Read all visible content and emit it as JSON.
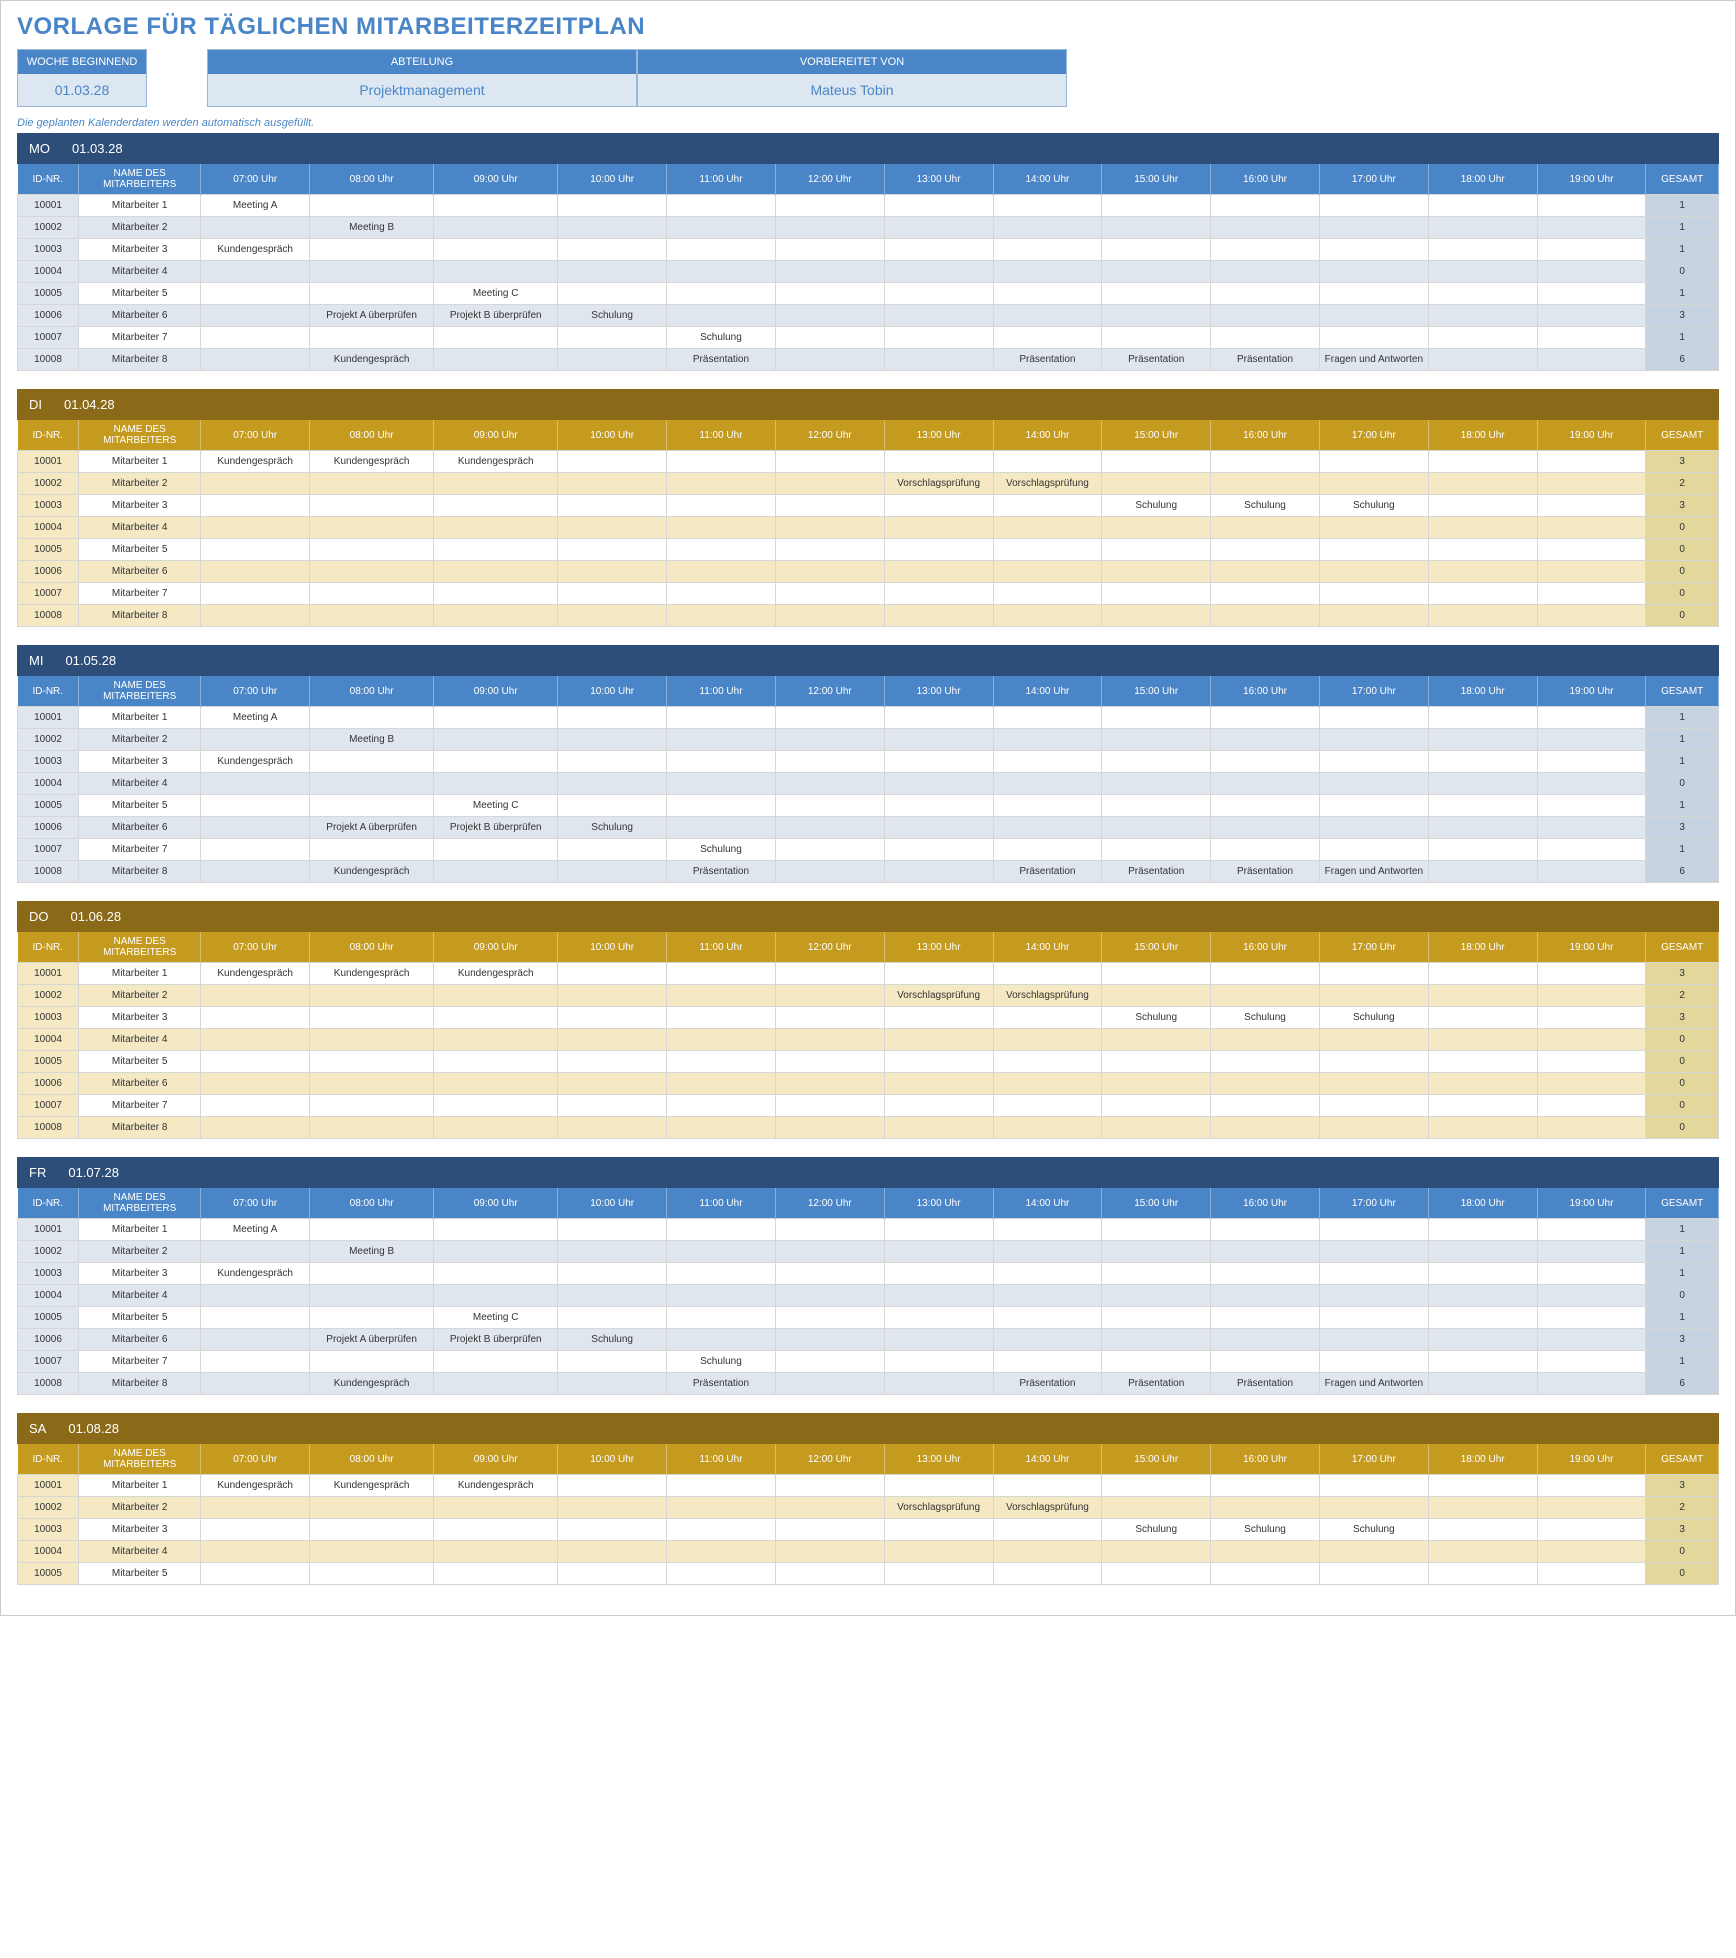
{
  "title": "VORLAGE FÜR TÄGLICHEN MITARBEITERZEITPLAN",
  "cards": {
    "week_label": "WOCHE BEGINNEND",
    "week_value": "01.03.28",
    "dept_label": "ABTEILUNG",
    "dept_value": "Projektmanagement",
    "prep_label": "VORBEREITET VON",
    "prep_value": "Mateus Tobin"
  },
  "note": "Die geplanten Kalenderdaten werden automatisch ausgefüllt.",
  "headers": {
    "id": "ID-NR.",
    "name": "NAME DES MITARBEITERS",
    "total": "GESAMT",
    "hours": [
      "07:00 Uhr",
      "08:00 Uhr",
      "09:00 Uhr",
      "10:00 Uhr",
      "11:00 Uhr",
      "12:00 Uhr",
      "13:00 Uhr",
      "14:00 Uhr",
      "15:00 Uhr",
      "16:00 Uhr",
      "17:00 Uhr",
      "18:00 Uhr",
      "19:00 Uhr"
    ]
  },
  "days": [
    {
      "theme": "blue",
      "code": "MO",
      "date": "01.03.28",
      "rows": [
        {
          "id": "10001",
          "name": "Mitarbeiter 1",
          "cells": [
            "Meeting A",
            "",
            "",
            "",
            "",
            "",
            "",
            "",
            "",
            "",
            "",
            "",
            ""
          ],
          "total": "1"
        },
        {
          "id": "10002",
          "name": "Mitarbeiter 2",
          "cells": [
            "",
            "Meeting B",
            "",
            "",
            "",
            "",
            "",
            "",
            "",
            "",
            "",
            "",
            ""
          ],
          "total": "1"
        },
        {
          "id": "10003",
          "name": "Mitarbeiter 3",
          "cells": [
            "Kundengespräch",
            "",
            "",
            "",
            "",
            "",
            "",
            "",
            "",
            "",
            "",
            "",
            ""
          ],
          "total": "1"
        },
        {
          "id": "10004",
          "name": "Mitarbeiter 4",
          "cells": [
            "",
            "",
            "",
            "",
            "",
            "",
            "",
            "",
            "",
            "",
            "",
            "",
            ""
          ],
          "total": "0"
        },
        {
          "id": "10005",
          "name": "Mitarbeiter 5",
          "cells": [
            "",
            "",
            "Meeting C",
            "",
            "",
            "",
            "",
            "",
            "",
            "",
            "",
            "",
            ""
          ],
          "total": "1"
        },
        {
          "id": "10006",
          "name": "Mitarbeiter 6",
          "cells": [
            "",
            "Projekt A überprüfen",
            "Projekt B überprüfen",
            "Schulung",
            "",
            "",
            "",
            "",
            "",
            "",
            "",
            "",
            ""
          ],
          "total": "3"
        },
        {
          "id": "10007",
          "name": "Mitarbeiter 7",
          "cells": [
            "",
            "",
            "",
            "",
            "Schulung",
            "",
            "",
            "",
            "",
            "",
            "",
            "",
            ""
          ],
          "total": "1"
        },
        {
          "id": "10008",
          "name": "Mitarbeiter 8",
          "cells": [
            "",
            "Kundengespräch",
            "",
            "",
            "Präsentation",
            "",
            "",
            "Präsentation",
            "Präsentation",
            "Präsentation",
            "Fragen und Antworten",
            "",
            ""
          ],
          "total": "6"
        }
      ]
    },
    {
      "theme": "brown",
      "code": "DI",
      "date": "01.04.28",
      "rows": [
        {
          "id": "10001",
          "name": "Mitarbeiter 1",
          "cells": [
            "Kundengespräch",
            "Kundengespräch",
            "Kundengespräch",
            "",
            "",
            "",
            "",
            "",
            "",
            "",
            "",
            "",
            ""
          ],
          "total": "3"
        },
        {
          "id": "10002",
          "name": "Mitarbeiter 2",
          "cells": [
            "",
            "",
            "",
            "",
            "",
            "",
            "Vorschlagsprüfung",
            "Vorschlagsprüfung",
            "",
            "",
            "",
            "",
            ""
          ],
          "total": "2"
        },
        {
          "id": "10003",
          "name": "Mitarbeiter 3",
          "cells": [
            "",
            "",
            "",
            "",
            "",
            "",
            "",
            "",
            "Schulung",
            "Schulung",
            "Schulung",
            "",
            ""
          ],
          "total": "3"
        },
        {
          "id": "10004",
          "name": "Mitarbeiter 4",
          "cells": [
            "",
            "",
            "",
            "",
            "",
            "",
            "",
            "",
            "",
            "",
            "",
            "",
            ""
          ],
          "total": "0"
        },
        {
          "id": "10005",
          "name": "Mitarbeiter 5",
          "cells": [
            "",
            "",
            "",
            "",
            "",
            "",
            "",
            "",
            "",
            "",
            "",
            "",
            ""
          ],
          "total": "0"
        },
        {
          "id": "10006",
          "name": "Mitarbeiter 6",
          "cells": [
            "",
            "",
            "",
            "",
            "",
            "",
            "",
            "",
            "",
            "",
            "",
            "",
            ""
          ],
          "total": "0"
        },
        {
          "id": "10007",
          "name": "Mitarbeiter 7",
          "cells": [
            "",
            "",
            "",
            "",
            "",
            "",
            "",
            "",
            "",
            "",
            "",
            "",
            ""
          ],
          "total": "0"
        },
        {
          "id": "10008",
          "name": "Mitarbeiter 8",
          "cells": [
            "",
            "",
            "",
            "",
            "",
            "",
            "",
            "",
            "",
            "",
            "",
            "",
            ""
          ],
          "total": "0"
        }
      ]
    },
    {
      "theme": "blue",
      "code": "MI",
      "date": "01.05.28",
      "rows": [
        {
          "id": "10001",
          "name": "Mitarbeiter 1",
          "cells": [
            "Meeting A",
            "",
            "",
            "",
            "",
            "",
            "",
            "",
            "",
            "",
            "",
            "",
            ""
          ],
          "total": "1"
        },
        {
          "id": "10002",
          "name": "Mitarbeiter 2",
          "cells": [
            "",
            "Meeting B",
            "",
            "",
            "",
            "",
            "",
            "",
            "",
            "",
            "",
            "",
            ""
          ],
          "total": "1"
        },
        {
          "id": "10003",
          "name": "Mitarbeiter 3",
          "cells": [
            "Kundengespräch",
            "",
            "",
            "",
            "",
            "",
            "",
            "",
            "",
            "",
            "",
            "",
            ""
          ],
          "total": "1"
        },
        {
          "id": "10004",
          "name": "Mitarbeiter 4",
          "cells": [
            "",
            "",
            "",
            "",
            "",
            "",
            "",
            "",
            "",
            "",
            "",
            "",
            ""
          ],
          "total": "0"
        },
        {
          "id": "10005",
          "name": "Mitarbeiter 5",
          "cells": [
            "",
            "",
            "Meeting C",
            "",
            "",
            "",
            "",
            "",
            "",
            "",
            "",
            "",
            ""
          ],
          "total": "1"
        },
        {
          "id": "10006",
          "name": "Mitarbeiter 6",
          "cells": [
            "",
            "Projekt A überprüfen",
            "Projekt B überprüfen",
            "Schulung",
            "",
            "",
            "",
            "",
            "",
            "",
            "",
            "",
            ""
          ],
          "total": "3"
        },
        {
          "id": "10007",
          "name": "Mitarbeiter 7",
          "cells": [
            "",
            "",
            "",
            "",
            "Schulung",
            "",
            "",
            "",
            "",
            "",
            "",
            "",
            ""
          ],
          "total": "1"
        },
        {
          "id": "10008",
          "name": "Mitarbeiter 8",
          "cells": [
            "",
            "Kundengespräch",
            "",
            "",
            "Präsentation",
            "",
            "",
            "Präsentation",
            "Präsentation",
            "Präsentation",
            "Fragen und Antworten",
            "",
            ""
          ],
          "total": "6"
        }
      ]
    },
    {
      "theme": "brown",
      "code": "DO",
      "date": "01.06.28",
      "rows": [
        {
          "id": "10001",
          "name": "Mitarbeiter 1",
          "cells": [
            "Kundengespräch",
            "Kundengespräch",
            "Kundengespräch",
            "",
            "",
            "",
            "",
            "",
            "",
            "",
            "",
            "",
            ""
          ],
          "total": "3"
        },
        {
          "id": "10002",
          "name": "Mitarbeiter 2",
          "cells": [
            "",
            "",
            "",
            "",
            "",
            "",
            "Vorschlagsprüfung",
            "Vorschlagsprüfung",
            "",
            "",
            "",
            "",
            ""
          ],
          "total": "2"
        },
        {
          "id": "10003",
          "name": "Mitarbeiter 3",
          "cells": [
            "",
            "",
            "",
            "",
            "",
            "",
            "",
            "",
            "Schulung",
            "Schulung",
            "Schulung",
            "",
            ""
          ],
          "total": "3"
        },
        {
          "id": "10004",
          "name": "Mitarbeiter 4",
          "cells": [
            "",
            "",
            "",
            "",
            "",
            "",
            "",
            "",
            "",
            "",
            "",
            "",
            ""
          ],
          "total": "0"
        },
        {
          "id": "10005",
          "name": "Mitarbeiter 5",
          "cells": [
            "",
            "",
            "",
            "",
            "",
            "",
            "",
            "",
            "",
            "",
            "",
            "",
            ""
          ],
          "total": "0"
        },
        {
          "id": "10006",
          "name": "Mitarbeiter 6",
          "cells": [
            "",
            "",
            "",
            "",
            "",
            "",
            "",
            "",
            "",
            "",
            "",
            "",
            ""
          ],
          "total": "0"
        },
        {
          "id": "10007",
          "name": "Mitarbeiter 7",
          "cells": [
            "",
            "",
            "",
            "",
            "",
            "",
            "",
            "",
            "",
            "",
            "",
            "",
            ""
          ],
          "total": "0"
        },
        {
          "id": "10008",
          "name": "Mitarbeiter 8",
          "cells": [
            "",
            "",
            "",
            "",
            "",
            "",
            "",
            "",
            "",
            "",
            "",
            "",
            ""
          ],
          "total": "0"
        }
      ]
    },
    {
      "theme": "blue",
      "code": "FR",
      "date": "01.07.28",
      "rows": [
        {
          "id": "10001",
          "name": "Mitarbeiter 1",
          "cells": [
            "Meeting A",
            "",
            "",
            "",
            "",
            "",
            "",
            "",
            "",
            "",
            "",
            "",
            ""
          ],
          "total": "1"
        },
        {
          "id": "10002",
          "name": "Mitarbeiter 2",
          "cells": [
            "",
            "Meeting B",
            "",
            "",
            "",
            "",
            "",
            "",
            "",
            "",
            "",
            "",
            ""
          ],
          "total": "1"
        },
        {
          "id": "10003",
          "name": "Mitarbeiter 3",
          "cells": [
            "Kundengespräch",
            "",
            "",
            "",
            "",
            "",
            "",
            "",
            "",
            "",
            "",
            "",
            ""
          ],
          "total": "1"
        },
        {
          "id": "10004",
          "name": "Mitarbeiter 4",
          "cells": [
            "",
            "",
            "",
            "",
            "",
            "",
            "",
            "",
            "",
            "",
            "",
            "",
            ""
          ],
          "total": "0"
        },
        {
          "id": "10005",
          "name": "Mitarbeiter 5",
          "cells": [
            "",
            "",
            "Meeting C",
            "",
            "",
            "",
            "",
            "",
            "",
            "",
            "",
            "",
            ""
          ],
          "total": "1"
        },
        {
          "id": "10006",
          "name": "Mitarbeiter 6",
          "cells": [
            "",
            "Projekt A überprüfen",
            "Projekt B überprüfen",
            "Schulung",
            "",
            "",
            "",
            "",
            "",
            "",
            "",
            "",
            ""
          ],
          "total": "3"
        },
        {
          "id": "10007",
          "name": "Mitarbeiter 7",
          "cells": [
            "",
            "",
            "",
            "",
            "Schulung",
            "",
            "",
            "",
            "",
            "",
            "",
            "",
            ""
          ],
          "total": "1"
        },
        {
          "id": "10008",
          "name": "Mitarbeiter 8",
          "cells": [
            "",
            "Kundengespräch",
            "",
            "",
            "Präsentation",
            "",
            "",
            "Präsentation",
            "Präsentation",
            "Präsentation",
            "Fragen und Antworten",
            "",
            ""
          ],
          "total": "6"
        }
      ]
    },
    {
      "theme": "brown",
      "code": "SA",
      "date": "01.08.28",
      "rows": [
        {
          "id": "10001",
          "name": "Mitarbeiter 1",
          "cells": [
            "Kundengespräch",
            "Kundengespräch",
            "Kundengespräch",
            "",
            "",
            "",
            "",
            "",
            "",
            "",
            "",
            "",
            ""
          ],
          "total": "3"
        },
        {
          "id": "10002",
          "name": "Mitarbeiter 2",
          "cells": [
            "",
            "",
            "",
            "",
            "",
            "",
            "Vorschlagsprüfung",
            "Vorschlagsprüfung",
            "",
            "",
            "",
            "",
            ""
          ],
          "total": "2"
        },
        {
          "id": "10003",
          "name": "Mitarbeiter 3",
          "cells": [
            "",
            "",
            "",
            "",
            "",
            "",
            "",
            "",
            "Schulung",
            "Schulung",
            "Schulung",
            "",
            ""
          ],
          "total": "3"
        },
        {
          "id": "10004",
          "name": "Mitarbeiter 4",
          "cells": [
            "",
            "",
            "",
            "",
            "",
            "",
            "",
            "",
            "",
            "",
            "",
            "",
            ""
          ],
          "total": "0"
        },
        {
          "id": "10005",
          "name": "Mitarbeiter 5",
          "cells": [
            "",
            "",
            "",
            "",
            "",
            "",
            "",
            "",
            "",
            "",
            "",
            "",
            ""
          ],
          "total": "0"
        }
      ]
    }
  ]
}
